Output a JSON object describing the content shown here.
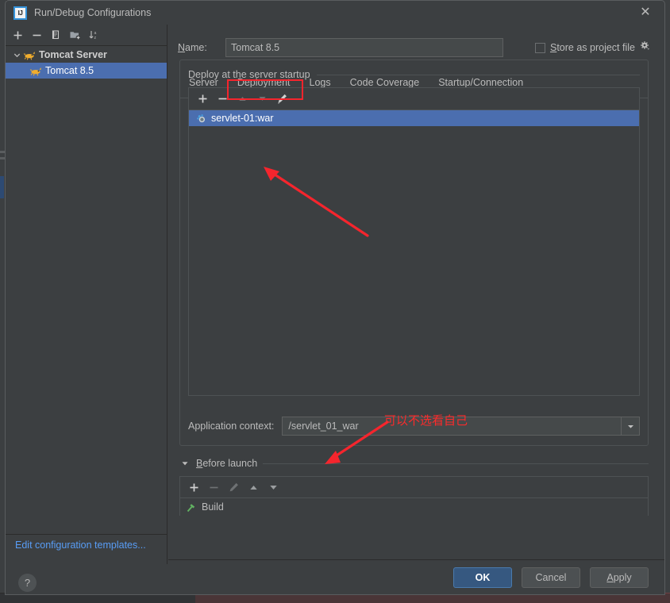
{
  "window": {
    "title": "Run/Debug Configurations",
    "logo_text": "IJ",
    "close_icon": "close-icon"
  },
  "sidebar": {
    "toolbar": [
      {
        "name": "add-configuration-button",
        "icon": "plus-icon"
      },
      {
        "name": "remove-configuration-button",
        "icon": "minus-icon"
      },
      {
        "name": "copy-configuration-button",
        "icon": "copy-icon"
      },
      {
        "name": "save-configuration-button",
        "icon": "folder-add-icon"
      },
      {
        "name": "sort-configurations-button",
        "icon": "sort-az-icon"
      }
    ],
    "tree": [
      {
        "label": "Tomcat Server",
        "type": "group",
        "expanded": true,
        "icon": "tomcat-icon",
        "selected": false
      },
      {
        "label": "Tomcat 8.5",
        "type": "item",
        "icon": "tomcat-icon",
        "selected": true
      }
    ],
    "edit_templates_link": "Edit configuration templates...",
    "help_label": "?"
  },
  "main": {
    "name_label": "Name:",
    "name_value": "Tomcat 8.5",
    "store_as_project_file": {
      "label": "Store as project file",
      "checked": false,
      "gear_icon": "gear-icon"
    },
    "tabs": [
      {
        "label": "Server",
        "active": false
      },
      {
        "label": "Deployment",
        "active": true
      },
      {
        "label": "Logs",
        "active": false
      },
      {
        "label": "Code Coverage",
        "active": false
      },
      {
        "label": "Startup/Connection",
        "active": false
      }
    ],
    "deployment": {
      "group_title": "Deploy at the server startup",
      "toolbar": [
        {
          "name": "add-artifact-button",
          "icon": "plus-icon",
          "enabled": true
        },
        {
          "name": "remove-artifact-button",
          "icon": "minus-icon",
          "enabled": true
        },
        {
          "name": "move-up-button",
          "icon": "arrow-up-icon",
          "enabled": false
        },
        {
          "name": "move-down-button",
          "icon": "arrow-down-icon",
          "enabled": false
        },
        {
          "name": "edit-artifact-button",
          "icon": "pencil-icon",
          "enabled": true
        }
      ],
      "items": [
        {
          "label": "servlet-01:war",
          "icon": "artifact-icon",
          "selected": true
        }
      ],
      "application_context_label": "Application context:",
      "application_context_value": "/servlet_01_war",
      "dropdown_icon": "chevron-down-icon"
    },
    "before_launch": {
      "title": "Before launch",
      "expanded": true,
      "toggle_icon": "triangle-down-icon",
      "toolbar": [
        {
          "name": "add-task-button",
          "icon": "plus-icon",
          "enabled": true
        },
        {
          "name": "remove-task-button",
          "icon": "minus-icon",
          "enabled": false
        },
        {
          "name": "edit-task-button",
          "icon": "pencil-icon",
          "enabled": false
        },
        {
          "name": "task-move-up-button",
          "icon": "arrow-up-icon",
          "enabled": true
        },
        {
          "name": "task-move-down-button",
          "icon": "arrow-down-icon",
          "enabled": true
        }
      ],
      "items": [
        {
          "label": "Build",
          "icon": "build-hammer-icon"
        }
      ]
    }
  },
  "footer": {
    "ok": "OK",
    "cancel": "Cancel",
    "apply": "Apply"
  },
  "annotations": {
    "accent_color": "#f5252d",
    "tab_highlight_target": "Deployment",
    "note_text": "可以不选看自己"
  }
}
